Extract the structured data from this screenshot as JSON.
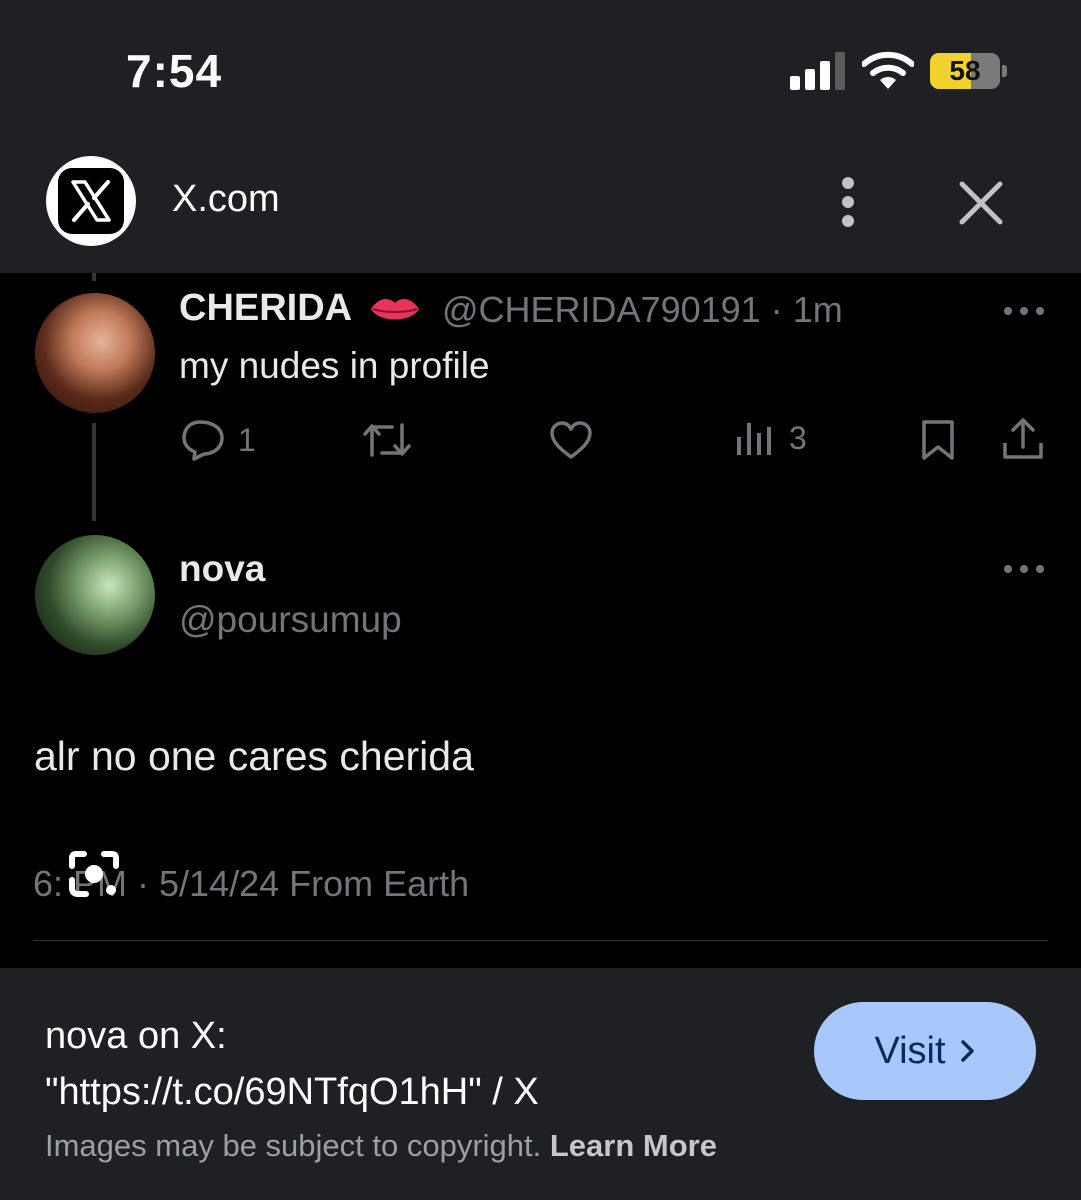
{
  "status_bar": {
    "time": "7:54",
    "battery": "58",
    "battery_level": 0.58
  },
  "header": {
    "site_name": "X.com"
  },
  "tweets": [
    {
      "name": "CHERIDA",
      "handle": "@CHERIDA790191",
      "time": "· 1m",
      "text": "my nudes in profile",
      "actions": {
        "replies": "1",
        "views": "3"
      }
    },
    {
      "name": "nova",
      "handle": "@poursumup",
      "text": "alr no one cares cherida",
      "meta": "6:   PM · 5/14/24 From Earth"
    }
  ],
  "card": {
    "title_line1": "nova on X:",
    "title_line2": "\"https://t.co/69NTfqO1hH\" / X",
    "visit_label": "Visit",
    "copyright_text": "Images may be subject to copyright.",
    "learn_more": "Learn More"
  },
  "colors": {
    "accent": "#a8c7fa",
    "battery": "#f2d22c",
    "muted": "#71767b"
  }
}
